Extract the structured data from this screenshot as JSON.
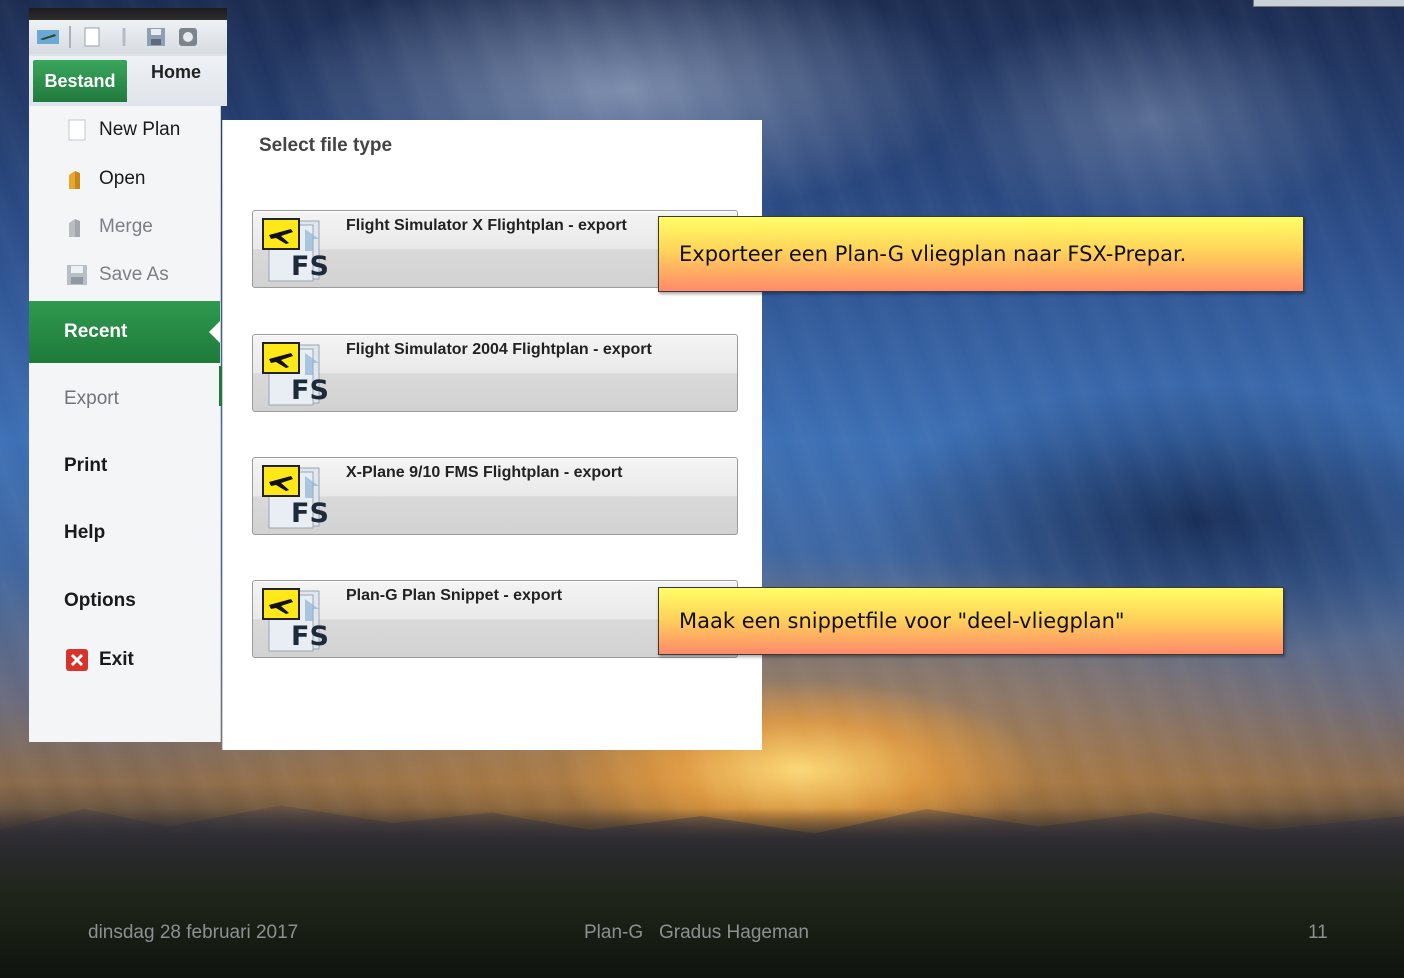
{
  "app": {
    "tabs": {
      "file": "Bestand",
      "home": "Home"
    },
    "backstage": {
      "commands": [
        {
          "label": "New Plan",
          "icon": "new-document-icon",
          "enabled": true
        },
        {
          "label": "Open",
          "icon": "folder-open-icon",
          "enabled": true
        },
        {
          "label": "Merge",
          "icon": "merge-icon",
          "enabled": false
        },
        {
          "label": "Save As",
          "icon": "save-icon",
          "enabled": false
        }
      ],
      "nav": {
        "recent": "Recent",
        "export": "Export",
        "print": "Print",
        "help": "Help",
        "options": "Options",
        "exit": "Exit"
      }
    },
    "export_panel": {
      "title": "Select file type",
      "options": [
        {
          "label": "Flight Simulator X Flightplan - export",
          "icon_text": "FS"
        },
        {
          "label": "Flight Simulator 2004 Flightplan - export",
          "icon_text": "FS"
        },
        {
          "label": "X-Plane 9/10 FMS Flightplan - export",
          "icon_text": "FS"
        },
        {
          "label": "Plan-G Plan Snippet - export",
          "icon_text": "FS"
        }
      ]
    }
  },
  "callouts": [
    "Exporteer een Plan-G vliegplan naar FSX-Prepar.",
    "Maak een snippetfile voor \"deel-vliegplan\""
  ],
  "footer": {
    "date": "dinsdag 28 februari 2017",
    "center": "Plan-G   Gradus Hageman",
    "page_number": "11"
  },
  "colors": {
    "accent_green": "#2f9a4f",
    "callout_top": "#ffff66",
    "callout_bottom": "#ff8a6a"
  }
}
